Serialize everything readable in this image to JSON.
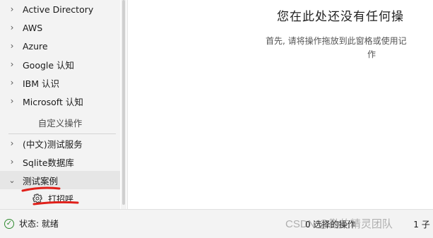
{
  "sidebar": {
    "items": [
      {
        "label": "Active Directory",
        "chevron": "chevron-right"
      },
      {
        "label": "AWS",
        "chevron": "chevron-right"
      },
      {
        "label": "Azure",
        "chevron": "chevron-right"
      },
      {
        "label": "Google 认知",
        "chevron": "chevron-right"
      },
      {
        "label": "IBM 认识",
        "chevron": "chevron-right"
      },
      {
        "label": "Microsoft 认知",
        "chevron": "chevron-right"
      }
    ],
    "section_header": "自定义操作",
    "custom_items": [
      {
        "label": "(中文)测试服务",
        "chevron": "chevron-right"
      },
      {
        "label": "Sqlite数据库",
        "chevron": "chevron-right"
      },
      {
        "label": "测试案例",
        "chevron": "chevron-down",
        "selected": true
      }
    ],
    "child_item": {
      "label": "打招呼",
      "icon": "gear-icon"
    }
  },
  "main": {
    "title": "您在此处还没有任何操",
    "description_line1": "首先, 请将操作拖放到此窗格或使用记",
    "description_line2": "作"
  },
  "statusbar": {
    "status_label": "状态: 就绪",
    "right_text": "0 选择的操作",
    "extra_text": "1 子"
  },
  "watermark": "CSDN @勤的精灵团队",
  "colors": {
    "annotation_red": "#e0201a",
    "status_ok": "#2f8a2f"
  }
}
